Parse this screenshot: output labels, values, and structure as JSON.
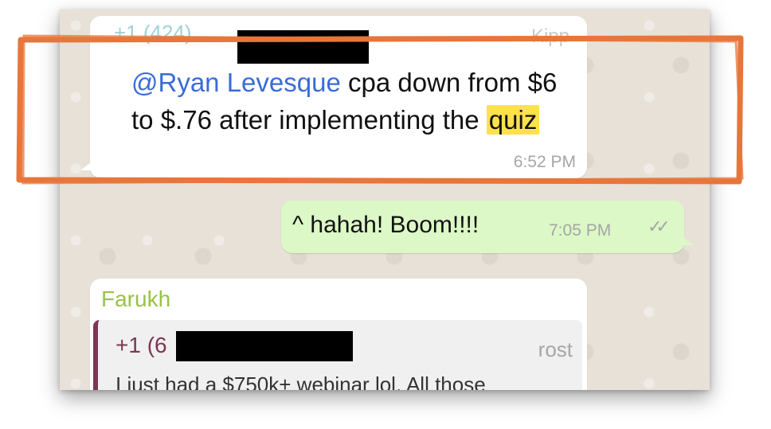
{
  "message_in_1": {
    "sender": "+1 (424)",
    "sender_hint": "Kipp",
    "mention": "@Ryan Levesque",
    "text_before_highlight": " cpa down from $6 to $.76 after implementing the ",
    "highlight": "quiz",
    "time": "6:52 PM"
  },
  "message_out_1": {
    "text": "^ hahah! Boom!!!!",
    "time": "7:05 PM",
    "status_icon": "double-check-icon"
  },
  "message_in_2": {
    "sender": "Farukh",
    "quote": {
      "sender": "+1 (6",
      "sender_hint": "rost",
      "text": "I just had a $750k+ webinar lol. All those"
    }
  },
  "colors": {
    "annotation_stroke": "#e8763a",
    "highlight": "#ffe14d",
    "mention": "#3a6cd6",
    "outgoing_bubble": "#dcf8c6",
    "quote_sender": "#7a3852",
    "farukh_name": "#98c344"
  }
}
